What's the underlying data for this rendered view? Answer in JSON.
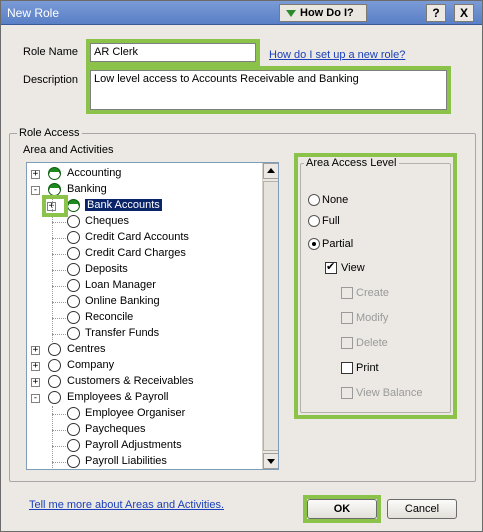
{
  "window": {
    "title": "New Role",
    "how_do_i": "How Do I?",
    "help_glyph": "?",
    "close_glyph": "X"
  },
  "form": {
    "role_name_label": "Role Name",
    "role_name_value": "AR Clerk",
    "role_name_help_link": "How do I set up a new role?",
    "description_label": "Description",
    "description_value": "Low level access to Accounts Receivable and Banking"
  },
  "role_access": {
    "group_title": "Role Access",
    "area_heading": "Area and Activities",
    "tree": [
      {
        "label": "Accounting",
        "level": 0,
        "expander": "+",
        "state": "half"
      },
      {
        "label": "Banking",
        "level": 0,
        "expander": "-",
        "state": "half"
      },
      {
        "label": "Bank Accounts",
        "level": 1,
        "expander": "+",
        "state": "half",
        "selected": true
      },
      {
        "label": "Cheques",
        "level": 1,
        "state": "none"
      },
      {
        "label": "Credit Card Accounts",
        "level": 1,
        "state": "none"
      },
      {
        "label": "Credit Card Charges",
        "level": 1,
        "state": "none"
      },
      {
        "label": "Deposits",
        "level": 1,
        "state": "none"
      },
      {
        "label": "Loan Manager",
        "level": 1,
        "state": "none"
      },
      {
        "label": "Online Banking",
        "level": 1,
        "state": "none"
      },
      {
        "label": "Reconcile",
        "level": 1,
        "state": "none"
      },
      {
        "label": "Transfer Funds",
        "level": 1,
        "state": "none"
      },
      {
        "label": "Centres",
        "level": 0,
        "expander": "+",
        "state": "none"
      },
      {
        "label": "Company",
        "level": 0,
        "expander": "+",
        "state": "none"
      },
      {
        "label": "Customers & Receivables",
        "level": 0,
        "expander": "+",
        "state": "none"
      },
      {
        "label": "Employees & Payroll",
        "level": 0,
        "expander": "-",
        "state": "none"
      },
      {
        "label": "Employee Organiser",
        "level": 1,
        "state": "none"
      },
      {
        "label": "Paycheques",
        "level": 1,
        "state": "none"
      },
      {
        "label": "Payroll Adjustments",
        "level": 1,
        "state": "none"
      },
      {
        "label": "Payroll Liabilities",
        "level": 1,
        "state": "none"
      }
    ],
    "access_level": {
      "title": "Area Access Level",
      "radios": [
        {
          "label": "None",
          "checked": false
        },
        {
          "label": "Full",
          "checked": false
        },
        {
          "label": "Partial",
          "checked": true
        }
      ],
      "checkboxes": [
        {
          "label": "View",
          "checked": true,
          "enabled": true
        },
        {
          "label": "Create",
          "checked": false,
          "enabled": false
        },
        {
          "label": "Modify",
          "checked": false,
          "enabled": false
        },
        {
          "label": "Delete",
          "checked": false,
          "enabled": false
        },
        {
          "label": "Print",
          "checked": false,
          "enabled": true
        },
        {
          "label": "View Balance",
          "checked": false,
          "enabled": false
        }
      ]
    }
  },
  "footer": {
    "more_link": "Tell me more about Areas and Activities.",
    "ok_label": "OK",
    "cancel_label": "Cancel"
  },
  "colors": {
    "highlight_green": "#8bc34a",
    "access_icon_green": "#1c8a1c",
    "link_blue": "#1a3fb8"
  }
}
